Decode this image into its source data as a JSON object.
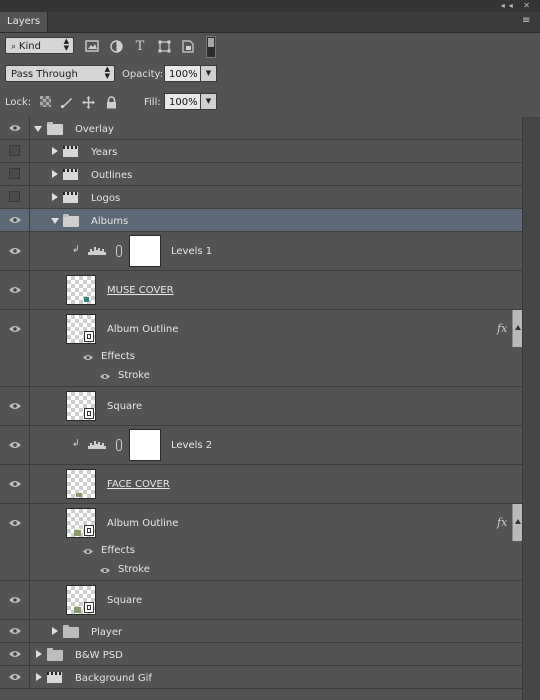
{
  "panel": {
    "tab_label": "Layers"
  },
  "filter": {
    "kind_label": "Kind",
    "icons": [
      "pixel-filter-icon",
      "adjustment-filter-icon",
      "type-filter-icon",
      "shape-filter-icon",
      "smart-object-filter-icon",
      "filter-toggle-icon"
    ]
  },
  "blend": {
    "mode": "Pass Through",
    "opacity_label": "Opacity:",
    "opacity_value": "100%"
  },
  "lock": {
    "label": "Lock:",
    "icons": [
      "lock-transparency-icon",
      "lock-image-icon",
      "lock-position-icon",
      "lock-all-icon"
    ],
    "fill_label": "Fill:",
    "fill_value": "100%"
  },
  "layers": [
    {
      "name": "Overlay",
      "kind": "group",
      "visible": true,
      "expanded": true
    },
    {
      "name": "Years",
      "kind": "video-group",
      "visible": false
    },
    {
      "name": "Outlines",
      "kind": "video-group",
      "visible": false
    },
    {
      "name": "Logos",
      "kind": "video-group",
      "visible": false
    },
    {
      "name": "Albums",
      "kind": "group",
      "visible": true,
      "expanded": true,
      "selected": true
    },
    {
      "name": "Levels 1",
      "kind": "adjustment",
      "visible": true
    },
    {
      "name": "MUSE COVER",
      "kind": "layer",
      "visible": true
    },
    {
      "name": "Album Outline",
      "kind": "smart",
      "visible": true,
      "effects_label": "Effects",
      "effect": "Stroke"
    },
    {
      "name": "Square",
      "kind": "smart",
      "visible": true
    },
    {
      "name": "Levels 2",
      "kind": "adjustment",
      "visible": true
    },
    {
      "name": "FACE COVER",
      "kind": "layer",
      "visible": true
    },
    {
      "name": "Album Outline",
      "kind": "smart",
      "visible": true,
      "effects_label": "Effects",
      "effect": "Stroke"
    },
    {
      "name": "Square",
      "kind": "smart",
      "visible": true
    },
    {
      "name": "Player",
      "kind": "group",
      "visible": true,
      "expanded": false
    },
    {
      "name": "B&W PSD",
      "kind": "group",
      "visible": true,
      "expanded": false
    },
    {
      "name": "Background Gif",
      "kind": "video-group",
      "visible": true,
      "expanded": false
    }
  ],
  "fx_label": "fx",
  "colors": {
    "panel_bg": "#535353",
    "selected_row": "#5d6977",
    "muse_thumb_accent": "#2f8a84",
    "face_thumb_accent": "#8a9a6a"
  }
}
